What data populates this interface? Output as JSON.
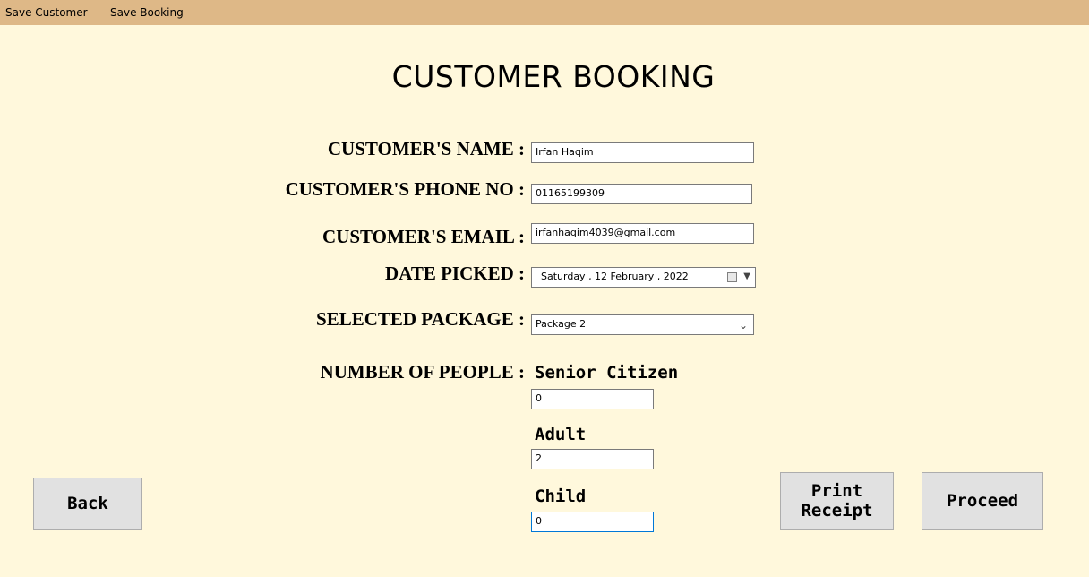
{
  "menu": {
    "items": [
      "Save Customer",
      "Save Booking"
    ]
  },
  "page": {
    "title": "CUSTOMER BOOKING"
  },
  "form": {
    "name_label": "CUSTOMER'S NAME :",
    "name_value": "Irfan Haqim",
    "phone_label": "CUSTOMER'S PHONE NO :",
    "phone_value": "01165199309",
    "email_label": "CUSTOMER'S EMAIL :",
    "email_value": "irfanhaqim4039@gmail.com",
    "date_label": "DATE PICKED :",
    "date_value": "Saturday  , 12  February  , 2022",
    "package_label": "SELECTED PACKAGE :",
    "package_value": "Package 2",
    "people_label": "NUMBER OF PEOPLE :"
  },
  "people": {
    "senior_label": "Senior Citizen",
    "senior_value": "0",
    "adult_label": "Adult",
    "adult_value": "2",
    "child_label": "Child",
    "child_value": "0"
  },
  "buttons": {
    "back": "Back",
    "print": "Print\nReceipt",
    "proceed": "Proceed"
  },
  "icons": {
    "date_picker": "calendar-icon",
    "dropdown": "chevron-down-icon"
  },
  "colors": {
    "background": "#fff8dc",
    "menubar": "#deb887",
    "button": "#e1e1e1",
    "focus_border": "#0078d7"
  }
}
